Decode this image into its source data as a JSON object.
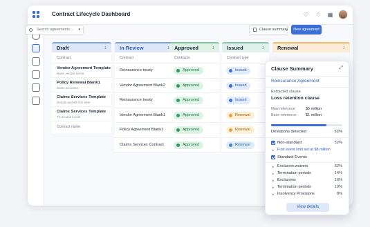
{
  "window": {
    "title": "Contract Lifecycle Dashboard"
  },
  "header_icons": [
    "bell-icon",
    "notification-icon",
    "columns-icon",
    "avatar"
  ],
  "sidebar_icons": [
    "circle-icon",
    "board-icon",
    "database-icon",
    "archive-icon",
    "list-icon",
    "monitor-icon"
  ],
  "toolbar": {
    "search_placeholder": "Search agreements...",
    "clause_summary_label": "Clause summary",
    "new_agreement_label": "New agreement"
  },
  "columns": {
    "draft": {
      "title": "Draft",
      "subheader": "Contract",
      "cards": [
        {
          "title": "Vendor Agreement Template",
          "subtitle": "Basic vendor terms"
        },
        {
          "title": "Policy Renewal Blank1",
          "subtitle": "Basic accounts"
        },
        {
          "title": "Claims Services Template",
          "subtitle": "Details and €0 hon etter"
        },
        {
          "title": "Claims Services Template",
          "subtitle": "Tro localal locale"
        }
      ],
      "footer": "Contract name"
    },
    "in_review": {
      "title": "In Review",
      "subheader": "Contract",
      "rows": [
        "Reinsurance treaty",
        "Vendor Agreement Blank2",
        "Reinsurance treaty",
        "Vendor Agreement Blank1",
        "Policy Agreement Blank1",
        "Claims Services Contract"
      ]
    },
    "approved": {
      "title": "Approved",
      "subheader": "Contracts",
      "rows": [
        "Approved",
        "Approved",
        "Approved",
        "Approved",
        "Approved",
        "Approved"
      ]
    },
    "issued": {
      "title": "Issued",
      "subheader": "Contract type",
      "rows": [
        "Issued",
        "Issued",
        "Issued",
        "Renewal",
        "Renewal",
        "Renewal"
      ]
    },
    "renewal": {
      "title": "Renewal"
    }
  },
  "clause_panel": {
    "title": "Clause Summary",
    "contract": "Reinsurance Agreement",
    "extracted_label": "Extracted clause",
    "clause_name": "Loss retention clause",
    "new_ref_label": "New reference:",
    "new_ref_value": "$5 million",
    "base_ref_label": "Base reference:",
    "base_ref_value": "$1 million",
    "progress_fraction": 0.78,
    "deviations_label": "Deviations detected",
    "deviations_value": "52%",
    "non_standard_label": "Non-standard",
    "non_standard_value": "52%",
    "first_event_note": "First event limit set at $8 million",
    "standard_events_label": "Standard Events",
    "items": [
      {
        "label": "Exclusion waivers",
        "value": "52%"
      },
      {
        "label": "Termination periods",
        "value": "14%"
      },
      {
        "label": "Exclusions",
        "value": "16%"
      },
      {
        "label": "Termination periods",
        "value": "10%"
      },
      {
        "label": "Insolvency Provisions",
        "value": "8%"
      }
    ],
    "view_details_label": "View details"
  },
  "colors": {
    "accent": "#3b6fd6",
    "draft_header": "#dde7f7",
    "in_review_header": "#dde7f7",
    "approved_header": "#dff1e6",
    "issued_header": "#e0f0ea",
    "renewal_header": "#fdecd5"
  }
}
